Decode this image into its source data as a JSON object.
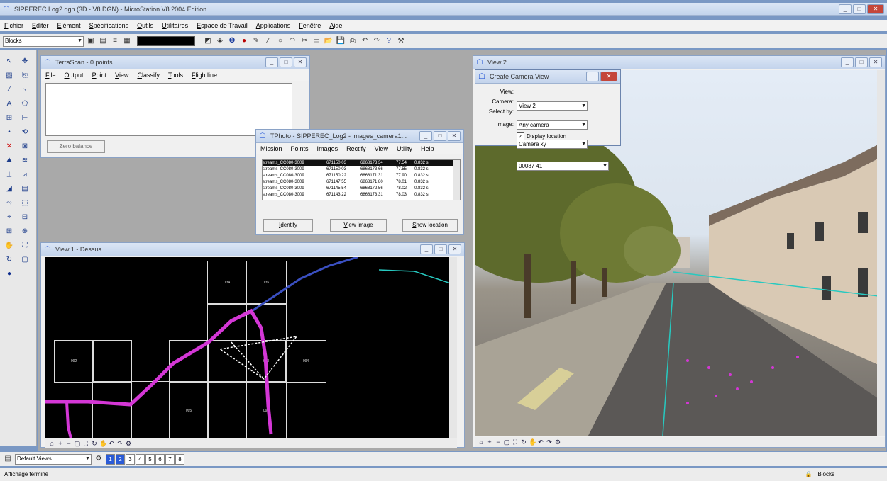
{
  "app": {
    "title": "SIPPEREC Log2.dgn (3D - V8 DGN) - MicroStation V8 2004 Edition",
    "menus": [
      "Fichier",
      "Editer",
      "Elément",
      "Spécifications",
      "Outils",
      "Utilitaires",
      "Espace de Travail",
      "Applications",
      "Fenêtre",
      "Aide"
    ],
    "level_combo": "Blocks",
    "status_left": "Affichage terminé",
    "status_right": "Blocks",
    "view_group_combo": "Default Views",
    "view_buttons": [
      "1",
      "2",
      "3",
      "4",
      "5",
      "6",
      "7",
      "8"
    ]
  },
  "terrascan": {
    "title": "TerraScan - 0 points",
    "menus": [
      "File",
      "Output",
      "Point",
      "View",
      "Classify",
      "Tools",
      "Flightline"
    ],
    "button_label": "Zero balance"
  },
  "tphoto": {
    "title": "TPhoto - SIPPEREC_Log2 - images_camera1...",
    "menus": [
      "Mission",
      "Points",
      "Images",
      "Rectify",
      "View",
      "Utility",
      "Help"
    ],
    "rows": [
      {
        "name": "streams_CC080-3009",
        "x": "671150.03",
        "y": "6868173.34",
        "z": "77.54",
        "t": "0.832 s",
        "selected": true
      },
      {
        "name": "streams_CC080-3009",
        "x": "671150.03",
        "y": "6868173.66",
        "z": "77.55",
        "t": "0.832 s",
        "selected": false
      },
      {
        "name": "streams_CC080-3009",
        "x": "671150.22",
        "y": "6868171.31",
        "z": "77.90",
        "t": "0.832 s",
        "selected": false
      },
      {
        "name": "streams_CC080-3009",
        "x": "671147.55",
        "y": "6868171.80",
        "z": "78.01",
        "t": "0.832 s",
        "selected": false
      },
      {
        "name": "streams_CC080-3009",
        "x": "671145.54",
        "y": "6868172.56",
        "z": "78.02",
        "t": "0.832 s",
        "selected": false
      },
      {
        "name": "streams_CC080-3009",
        "x": "671143.22",
        "y": "6868173.31",
        "z": "78.03",
        "t": "0.832 s",
        "selected": false
      }
    ],
    "buttons": [
      "Identify",
      "View image",
      "Show location"
    ]
  },
  "view1": {
    "title": "View 1 - Dessus",
    "grid_labels": [
      "134",
      "135",
      "092",
      "093",
      "094",
      "095",
      "096"
    ]
  },
  "view2": {
    "title": "View 2"
  },
  "camera_dialog": {
    "title": "Create Camera View",
    "view_label": "View:",
    "view_value": "View 2",
    "camera_label": "Camera:",
    "camera_value": "Any camera",
    "select_label": "Select by:",
    "select_value": "Camera xy",
    "image_label": "Image:",
    "image_value": "00087 41",
    "checkbox_label": "Display location",
    "checkbox_checked": true
  },
  "colors": {
    "accent": "#2a5bd7",
    "trajectory": "#d437d6",
    "polyline": "#3a4fc0",
    "cyan_line": "#27c9c0"
  }
}
